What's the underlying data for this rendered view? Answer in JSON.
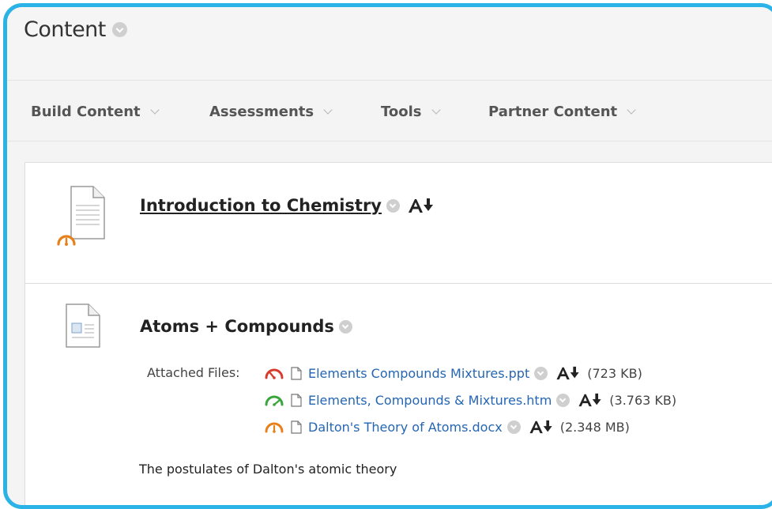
{
  "page": {
    "title": "Content"
  },
  "menu": {
    "items": [
      {
        "label": "Build Content"
      },
      {
        "label": "Assessments"
      },
      {
        "label": "Tools"
      },
      {
        "label": "Partner Content"
      }
    ]
  },
  "content": {
    "items": [
      {
        "title": "Introduction to Chemistry"
      },
      {
        "title": "Atoms + Compounds",
        "attached_label": "Attached Files:",
        "files": [
          {
            "name": "Elements Compounds Mixtures.ppt",
            "size": "(723 KB)",
            "score_color": "#d63b2b"
          },
          {
            "name": "Elements, Compounds & Mixtures.htm",
            "size": "(3.763 KB)",
            "score_color": "#3aa53a"
          },
          {
            "name": "Dalton's Theory of Atoms.docx",
            "size": "(2.348 MB)",
            "score_color": "#e8801a"
          }
        ],
        "description": "The postulates of Dalton's atomic theory"
      }
    ],
    "item1_score_color": "#e8801a"
  },
  "colors": {
    "frame": "#2bb3e8",
    "link": "#2566b3"
  }
}
